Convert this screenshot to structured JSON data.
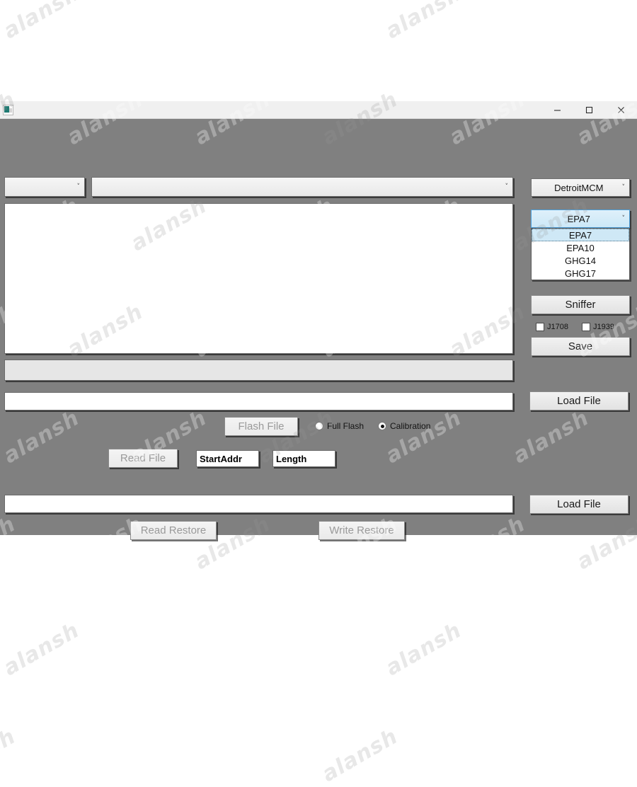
{
  "window": {
    "title": "",
    "icon": "app-icon",
    "controls": {
      "minimize": "–",
      "maximize": "□",
      "close": "✕"
    }
  },
  "colors": {
    "background": "#808080",
    "titlebar": "#f0f0f0",
    "field": "#ffffff",
    "button": "#eaeaea",
    "selection_blue": "#cce8f7",
    "selection_border": "#4c9ed9",
    "disabled_text": "#9a9a9a"
  },
  "top_row": {
    "port_combo": {
      "value": "",
      "chevron": "˅"
    },
    "device_combo": {
      "value": "",
      "chevron": "˅"
    }
  },
  "log": {
    "value": ""
  },
  "progress": {
    "value": "",
    "percent": 0
  },
  "flash_path_field": {
    "value": "",
    "placeholder": ""
  },
  "flash_row": {
    "flash_file_label": "Flash File",
    "flash_file_disabled": true,
    "radios": [
      {
        "label": "Full Flash",
        "selected": false
      },
      {
        "label": "Calibration",
        "selected": true
      }
    ]
  },
  "read_row": {
    "read_file_label": "Read File",
    "read_file_disabled": true,
    "start_addr": {
      "value": "StartAddr"
    },
    "length": {
      "value": "Length"
    }
  },
  "restore_path_field": {
    "value": ""
  },
  "restore_row": {
    "read_restore_label": "Read Restore",
    "read_restore_disabled": true,
    "write_restore_label": "Write Restore",
    "write_restore_disabled": true
  },
  "right_panel": {
    "brand_combo": {
      "value": "DetroitMCM",
      "chevron": "˅"
    },
    "emission_combo": {
      "value": "EPA7",
      "chevron": "˅",
      "expanded": true
    },
    "emission_options": [
      {
        "label": "EPA7",
        "active": true
      },
      {
        "label": "EPA10",
        "active": false
      },
      {
        "label": "GHG14",
        "active": false
      },
      {
        "label": "GHG17",
        "active": false
      }
    ],
    "sniffer_label": "Sniffer",
    "checkboxes": [
      {
        "label": "J1708",
        "checked": false
      },
      {
        "label": "J1939",
        "checked": false
      }
    ],
    "save_label": "Save",
    "load_file_top_label": "Load File",
    "load_file_bottom_label": "Load File"
  },
  "watermark": {
    "text": "alansh"
  }
}
